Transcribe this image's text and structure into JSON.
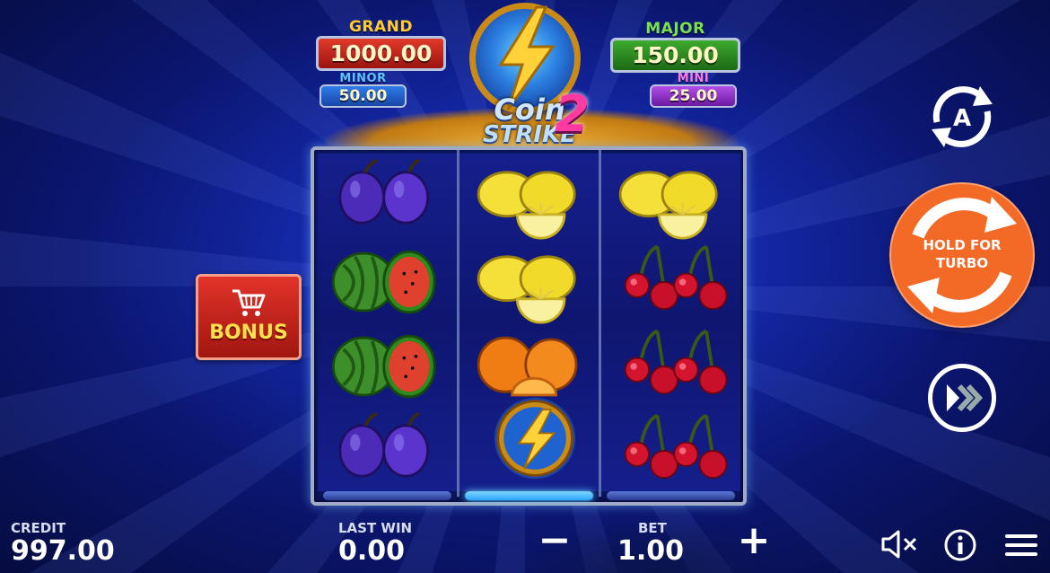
{
  "jackpots": {
    "grand": {
      "label": "GRAND",
      "value": "1000.00"
    },
    "major": {
      "label": "MAJOR",
      "value": "150.00"
    },
    "minor": {
      "label": "MINOR",
      "value": "50.00"
    },
    "mini": {
      "label": "MINI",
      "value": "25.00"
    }
  },
  "logo": {
    "line1": "Coin",
    "line2": "STRIKE",
    "number": "2"
  },
  "reels": [
    [
      "plum",
      "watermelon",
      "watermelon",
      "plum"
    ],
    [
      "lemon",
      "lemon",
      "orange",
      "coin"
    ],
    [
      "lemon",
      "cherry",
      "cherry",
      "cherry"
    ]
  ],
  "bonus": {
    "label": "BONUS",
    "icon": "cart-icon"
  },
  "controls": {
    "autoplay_icon": "autoplay-icon",
    "autoplay_letter": "A",
    "spin_label": "HOLD FOR\nTURBO",
    "fastplay_icon": "fast-forward-icon"
  },
  "footer": {
    "credit_label": "CREDIT",
    "credit_value": "997.00",
    "lastwin_label": "LAST WIN",
    "lastwin_value": "0.00",
    "bet_label": "BET",
    "bet_value": "1.00",
    "minus": "−",
    "plus": "+",
    "icons": [
      "sound-muted-icon",
      "info-icon",
      "menu-icon"
    ]
  },
  "colors": {
    "background": "#1428a8",
    "spin_button": "#f26a26",
    "bonus": "#e2332a",
    "grand": "#e23a2a",
    "major": "#3eaa2e",
    "minor": "#2f7ce8",
    "mini": "#b24ee8"
  }
}
